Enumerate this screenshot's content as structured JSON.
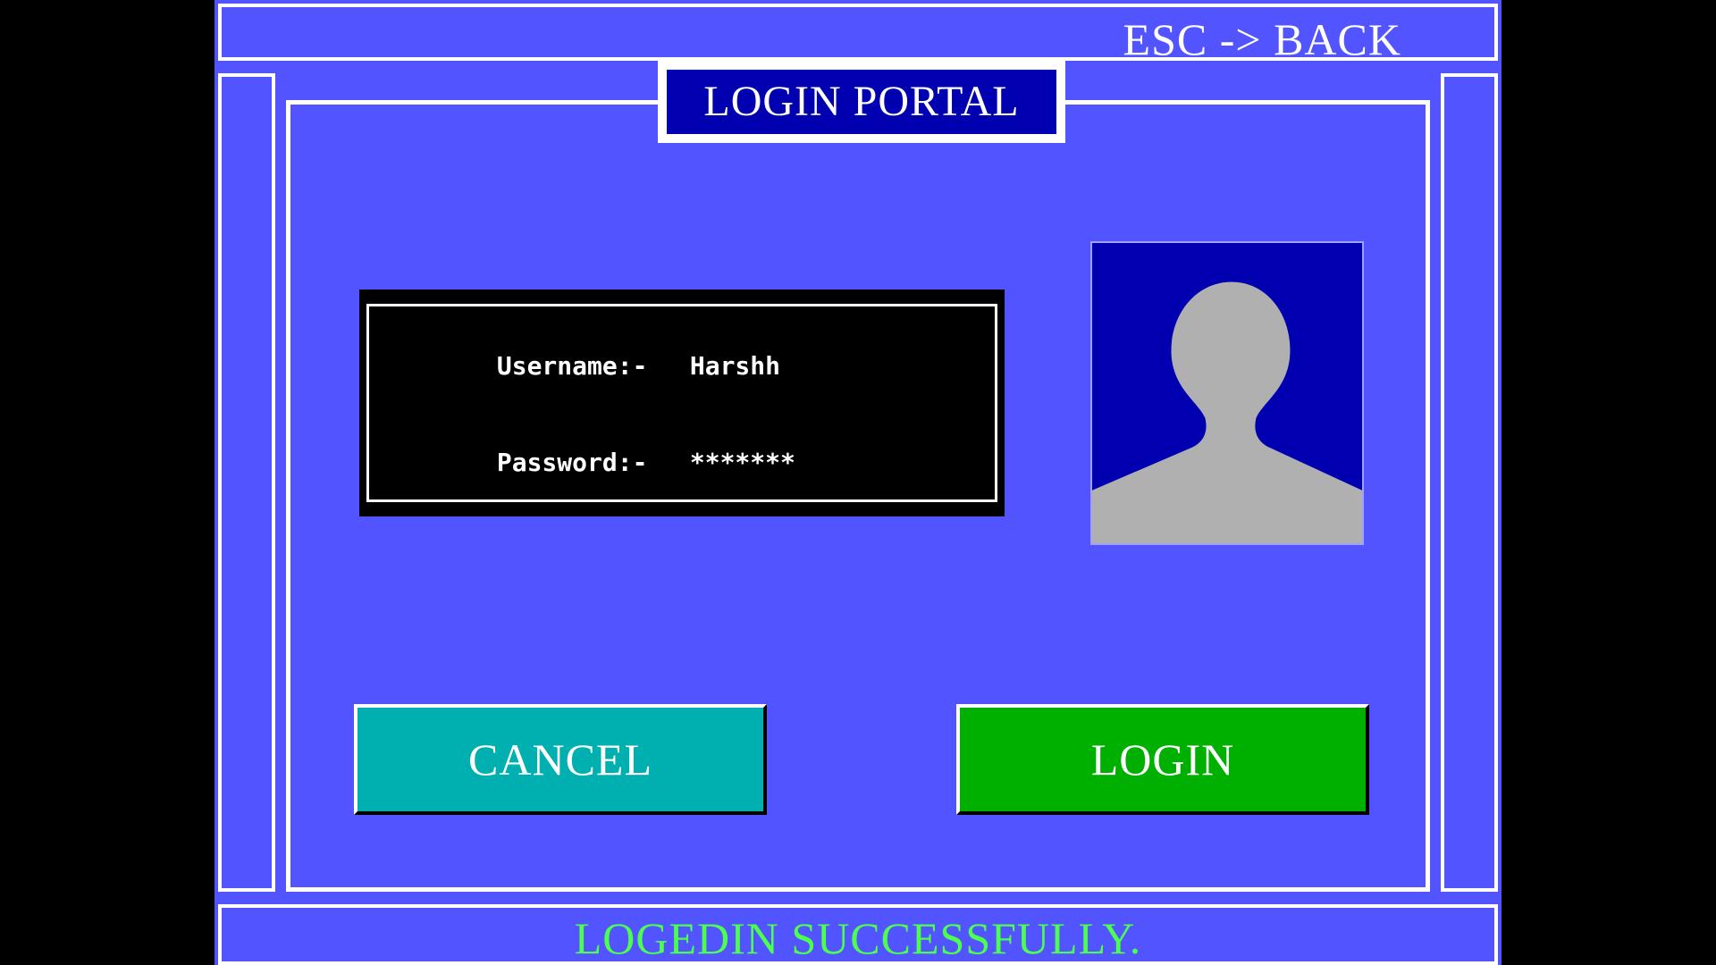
{
  "header": {
    "esc_hint": "ESC -> BACK"
  },
  "portal": {
    "title": "LOGIN PORTAL"
  },
  "form": {
    "username_label": "Username:-",
    "username_value": "Harshh",
    "password_label": "Password:-",
    "password_value": "*******"
  },
  "avatar": {
    "icon": "user-silhouette-icon"
  },
  "buttons": {
    "cancel_label": "CANCEL",
    "login_label": "LOGIN"
  },
  "status": {
    "message": "LOGEDIN SUCCESSFULLY."
  },
  "colors": {
    "background": "#5255ff",
    "title_bg": "#0000b0",
    "cancel_bg": "#00b0b0",
    "login_bg": "#00b000",
    "status_text": "#4cff4c",
    "avatar_bg": "#0000b0",
    "avatar_fg": "#b0b0b0"
  }
}
